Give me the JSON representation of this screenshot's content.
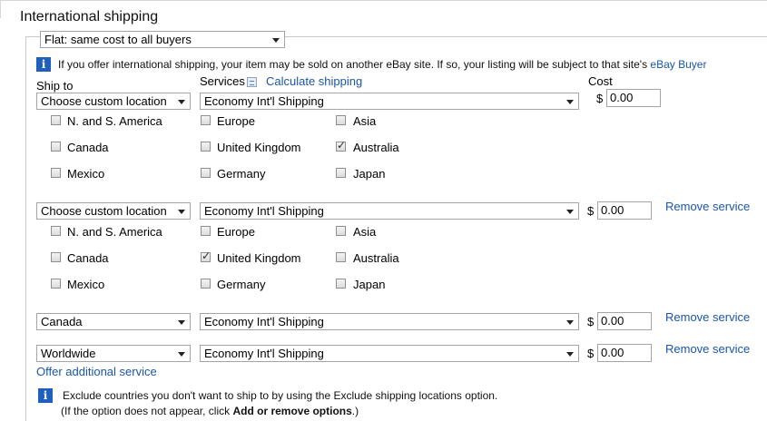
{
  "section": {
    "title": "International shipping"
  },
  "shipping_type": {
    "value": "Flat: same cost to all buyers"
  },
  "info1": {
    "text": "If you offer international shipping, your item may be sold on another eBay site. If so, your listing will be subject to that site's",
    "link": "eBay Buyer"
  },
  "headers": {
    "ship_to": "Ship to",
    "services": "Services",
    "calculate": "Calculate shipping",
    "cost": "Cost"
  },
  "currency": "$",
  "rows": [
    {
      "ship_to": "Choose custom location",
      "service": "Economy Int'l Shipping",
      "cost": "0.00",
      "remove": "",
      "regions": [
        {
          "label": "N. and S. America",
          "checked": false
        },
        {
          "label": "Europe",
          "checked": false
        },
        {
          "label": "Asia",
          "checked": false
        },
        {
          "label": "Canada",
          "checked": false
        },
        {
          "label": "United Kingdom",
          "checked": false
        },
        {
          "label": "Australia",
          "checked": true
        },
        {
          "label": "Mexico",
          "checked": false
        },
        {
          "label": "Germany",
          "checked": false
        },
        {
          "label": "Japan",
          "checked": false
        }
      ]
    },
    {
      "ship_to": "Choose custom location",
      "service": "Economy Int'l Shipping",
      "cost": "0.00",
      "remove": "Remove service",
      "regions": [
        {
          "label": "N. and S. America",
          "checked": false
        },
        {
          "label": "Europe",
          "checked": false
        },
        {
          "label": "Asia",
          "checked": false
        },
        {
          "label": "Canada",
          "checked": false
        },
        {
          "label": "United Kingdom",
          "checked": true
        },
        {
          "label": "Australia",
          "checked": false
        },
        {
          "label": "Mexico",
          "checked": false
        },
        {
          "label": "Germany",
          "checked": false
        },
        {
          "label": "Japan",
          "checked": false
        }
      ]
    },
    {
      "ship_to": "Canada",
      "service": "Economy Int'l Shipping",
      "cost": "0.00",
      "remove": "Remove service"
    },
    {
      "ship_to": "Worldwide",
      "service": "Economy Int'l Shipping",
      "cost": "0.00",
      "remove": "Remove service"
    }
  ],
  "offer_additional": "Offer additional service",
  "info2": {
    "line1": "Exclude countries you don't want to ship to by using the Exclude shipping locations option.",
    "line2_pre": "(If the option does not appear, click ",
    "line2_bold": "Add or remove options",
    "line2_post": ".)"
  },
  "colors": {
    "link": "#1a56a8",
    "info_icon": "#1f5fbf"
  },
  "icons": {
    "info": "info-icon",
    "services": "services-help-icon",
    "dropdown": "chevron-down-icon",
    "checkbox": "checkbox"
  }
}
